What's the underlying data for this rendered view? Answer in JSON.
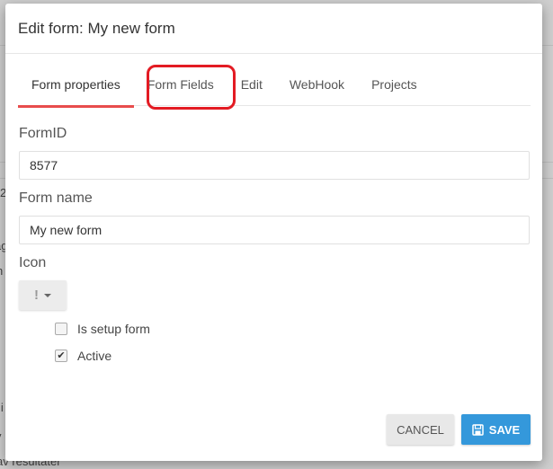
{
  "background": {
    "fragments": [
      "2",
      "ag",
      "n",
      "li",
      "y",
      "av resultater"
    ]
  },
  "modal": {
    "title": "Edit form: My new form",
    "tabs": [
      {
        "label": "Form properties",
        "active": true
      },
      {
        "label": "Form Fields",
        "active": false,
        "highlighted": true
      },
      {
        "label": "Edit",
        "active": false
      },
      {
        "label": "WebHook",
        "active": false
      },
      {
        "label": "Projects",
        "active": false
      }
    ],
    "fields": {
      "form_id": {
        "label": "FormID",
        "value": "8577"
      },
      "form_name": {
        "label": "Form name",
        "value": "My new form"
      },
      "icon": {
        "label": "Icon",
        "selected_glyph": "!"
      }
    },
    "checkboxes": [
      {
        "label": "Is setup form",
        "checked": false
      },
      {
        "label": "Active",
        "checked": true
      }
    ],
    "buttons": {
      "cancel": "CANCEL",
      "save": "SAVE"
    },
    "colors": {
      "active_tab_underline": "#e84c4c",
      "highlight_box": "#e31b23",
      "save_button": "#3498db"
    }
  }
}
